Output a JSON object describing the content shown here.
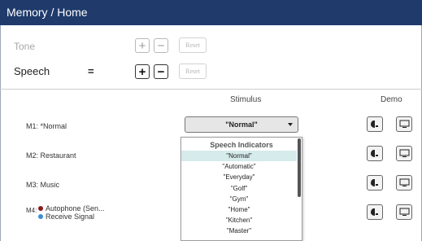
{
  "header": {
    "title": "Memory / Home"
  },
  "tone": {
    "label": "Tone",
    "plus": "+",
    "minus": "−",
    "reset": "Reset"
  },
  "speech": {
    "label": "Speech",
    "value": "=",
    "plus": "+",
    "minus": "−",
    "reset": "Reset"
  },
  "columns": {
    "stimulus": "Stimulus",
    "demo": "Demo"
  },
  "memories": [
    {
      "label": "M1: *Normal"
    },
    {
      "label": "M2: Restaurant"
    },
    {
      "label": "M3: Music"
    },
    {
      "label": "M4:",
      "lines": [
        "Autophone (Sen...",
        "Receive Signal"
      ]
    }
  ],
  "m4_colors": [
    "#8b1a1a",
    "#3a8fd6"
  ],
  "stimulus_select": {
    "value": "\"Normal\""
  },
  "dropdown": {
    "header": "Speech Indicators",
    "items": [
      "\"Normal\"",
      "\"Automatic\"",
      "\"Everyday\"",
      "\"Golf\"",
      "\"Gym\"",
      "\"Home\"",
      "\"Kitchen\"",
      "\"Master\""
    ],
    "selected_index": 0
  },
  "icons": {
    "demo_left": "ear-speaker-icon",
    "demo_right": "monitor-icon"
  },
  "colors": {
    "title_bar": "#1f3a6b",
    "selected_item": "#d6ebeb"
  }
}
